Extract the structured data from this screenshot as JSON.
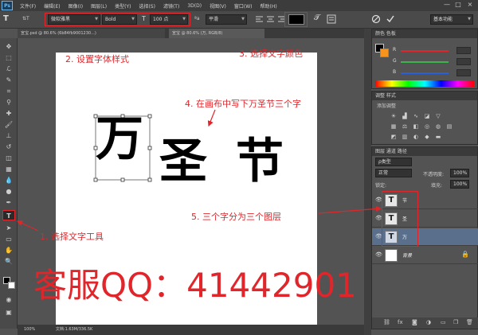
{
  "app": {
    "logo": "Ps"
  },
  "menu": [
    "文件(F)",
    "编辑(E)",
    "图像(I)",
    "图层(L)",
    "类型(Y)",
    "选择(S)",
    "滤镜(T)",
    "3D(D)",
    "视图(V)",
    "窗口(W)",
    "帮助(H)"
  ],
  "window_controls": [
    "—",
    "□",
    "×"
  ],
  "options": {
    "tool_glyph": "T",
    "orient_glyph": "⇅T",
    "font_family": "微软雅黑",
    "font_style": "Bold",
    "size_glyph": "T",
    "font_size": "100 点",
    "aa_label": "ªa",
    "aa_value": "平滑",
    "color_label": "",
    "workspace": "基本功能"
  },
  "doc_tabs": [
    "宣宝.psd @ 80.6% (6b84fb9001230...)",
    "宣宝 @ 80.6% (万, RGB/8)"
  ],
  "status": {
    "zoom": "100%",
    "doc": "文档:1.63M/336.5K"
  },
  "canvas_text": [
    "万",
    "圣",
    "节"
  ],
  "watermark": "客服QQ：41442901",
  "color_panel": {
    "tabs": "颜色  色板",
    "labels": [
      "R",
      "G",
      "B"
    ],
    "colors": {
      "fg": "#000000",
      "bg": "#f7941d",
      "r": "#e0262b",
      "g": "#3cb44b",
      "b": "#2b5fd9"
    }
  },
  "adjust_panel": {
    "tabs": "调整  样式",
    "add": "添加调整"
  },
  "layers_panel": {
    "tabs": "图层  通道  路径",
    "kind": "ρ类型",
    "blend": "正常",
    "opacity_label": "不透明度:",
    "opacity": "100%",
    "lock_label": "锁定:",
    "fill_label": "填充:",
    "fill": "100%",
    "layers": [
      {
        "name": "节",
        "type": "T"
      },
      {
        "name": "圣",
        "type": "T"
      },
      {
        "name": "万",
        "type": "T"
      },
      {
        "name": "背景",
        "type": ""
      }
    ]
  },
  "annotations": {
    "a1": "1. 选择文字工具",
    "a2": "2. 设置字体样式",
    "a3": "3. 选择文字颜色",
    "a4": "4. 在画布中写下万圣节三个字",
    "a5": "5. 三个字分为三个图层"
  }
}
